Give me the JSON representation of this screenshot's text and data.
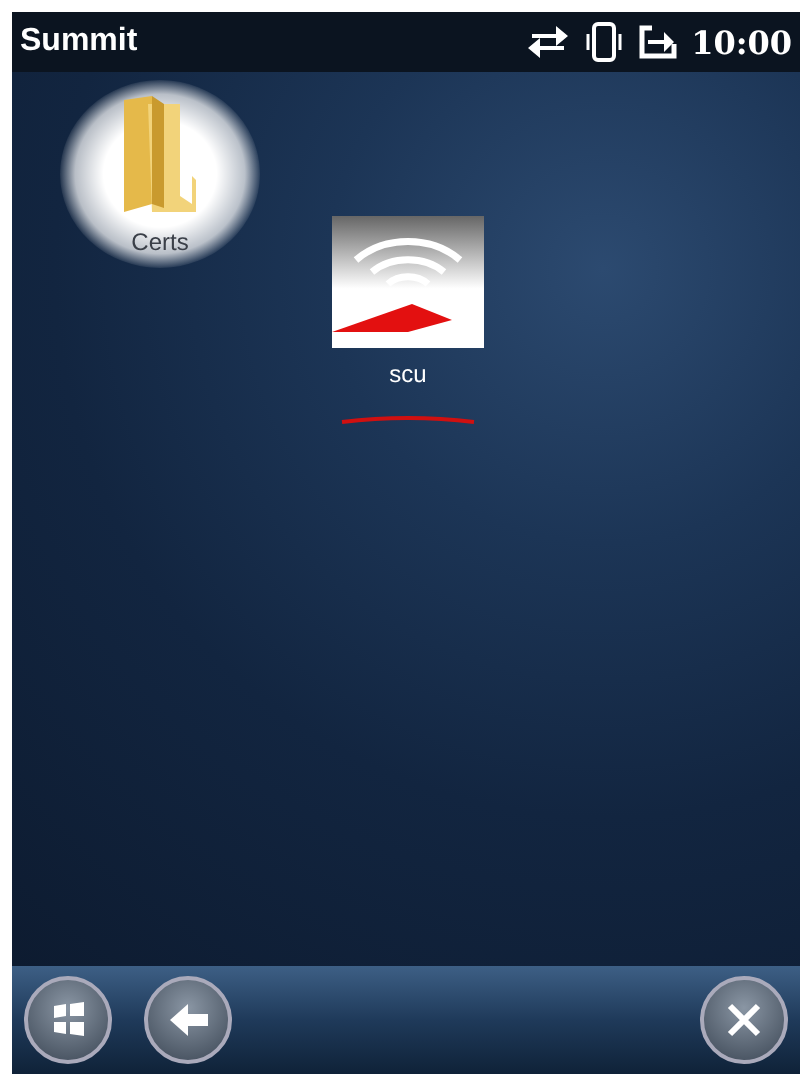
{
  "status_bar": {
    "title": "Summit",
    "time": "10:00"
  },
  "desktop_items": [
    {
      "label": "Certs",
      "kind": "folder",
      "selected": true
    },
    {
      "label": "scu",
      "kind": "app",
      "selected": false,
      "underlined": true
    }
  ],
  "taskbar": {
    "buttons": [
      {
        "kind": "start"
      },
      {
        "kind": "back"
      },
      {
        "kind": "close"
      }
    ]
  }
}
